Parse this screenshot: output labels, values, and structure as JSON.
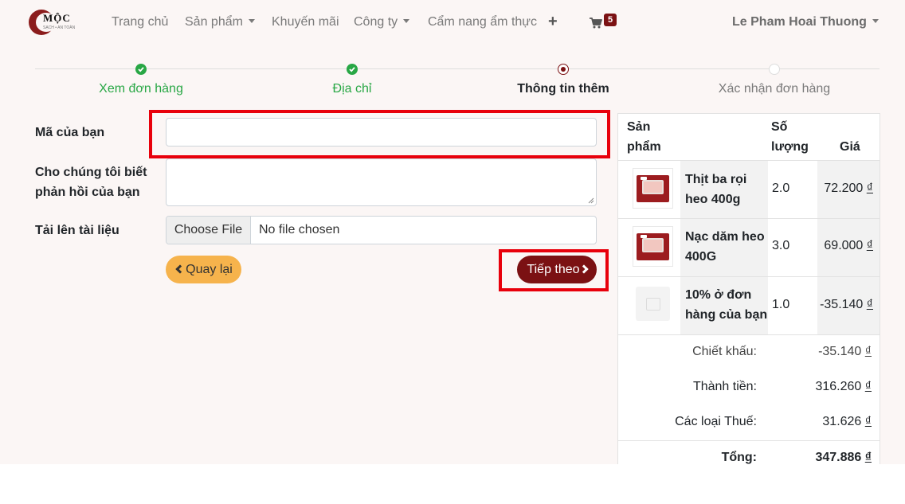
{
  "brand": {
    "logo_text": "MỘC",
    "logo_tagline": "SẠCH • AN TOÀN"
  },
  "nav": {
    "home": "Trang chủ",
    "products": "Sản phẩm",
    "promotions": "Khuyến mãi",
    "company": "Công ty",
    "cooking_guide": "Cẩm nang ẩm thực",
    "cart_count": "5",
    "user_name": "Le Pham Hoai Thuong"
  },
  "steps": [
    {
      "label": "Xem đơn hàng",
      "state": "done"
    },
    {
      "label": "Địa chỉ",
      "state": "done"
    },
    {
      "label": "Thông tin thêm",
      "state": "current"
    },
    {
      "label": "Xác nhận đơn hàng",
      "state": "todo"
    }
  ],
  "form": {
    "code_label": "Mã của bạn",
    "code_value": "",
    "feedback_label": "Cho chúng tôi biết phản hồi của bạn",
    "feedback_value": "",
    "upload_label": "Tải lên tài liệu",
    "choose_file": "Choose File",
    "no_file": "No file chosen",
    "back_button": "Quay lại",
    "next_button": "Tiếp theo"
  },
  "summary": {
    "headers": {
      "product": "Sản phẩm",
      "quantity": "Số lượng",
      "price": "Giá"
    },
    "items": [
      {
        "name": "Thịt ba rọi heo 400g",
        "quantity": "2.0",
        "price": "72.200",
        "currency": "₫"
      },
      {
        "name": "Nạc dăm heo 400G",
        "quantity": "3.0",
        "price": "69.000",
        "currency": "₫"
      },
      {
        "name": "10% ở đơn hàng của bạn",
        "quantity": "1.0",
        "price": "-35.140",
        "currency": "₫"
      }
    ],
    "totals": {
      "discount_label": "Chiết khấu:",
      "discount_value": "-35.140",
      "subtotal_label": "Thành tiền:",
      "subtotal_value": "316.260",
      "tax_label": "Các loại Thuế:",
      "tax_value": "31.626",
      "total_label": "Tổng:",
      "total_value": "347.886",
      "currency": "₫"
    }
  },
  "colors": {
    "brand": "#7b1113",
    "success": "#28a745",
    "back_button": "#f6b34c",
    "highlight": "#e8000b",
    "background": "#fbf6f5"
  },
  "icons": {
    "step_done": "check-icon",
    "plus": "plus-icon",
    "cart": "cart-icon",
    "dropdown": "caret-down-icon"
  }
}
